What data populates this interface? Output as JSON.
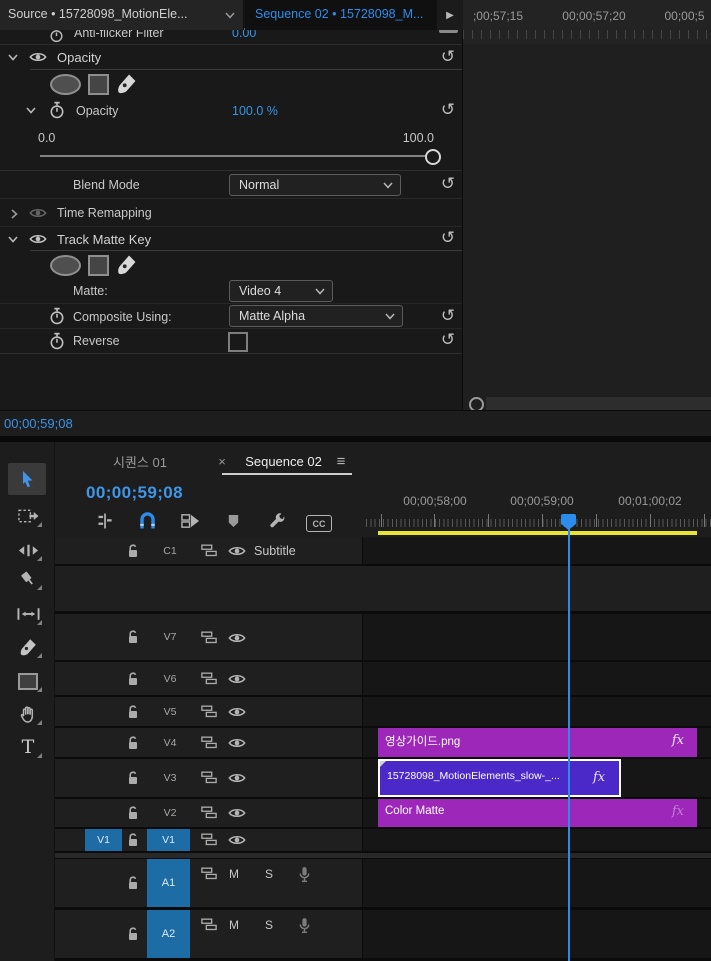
{
  "glyphs": {
    "reset": "↺",
    "panel_arrow": "▶",
    "tab_close": "×",
    "tab_menu": "≡",
    "type_tool": "T"
  },
  "effect_controls": {
    "source_tab": "Source • 15728098_MotionEle...",
    "sequence_tab": "Sequence 02 • 15728098_M...",
    "ruler": {
      "t1": ";00;57;15",
      "t2": "00;00;57;20",
      "t3": "00;00;5"
    },
    "anti_flicker": {
      "label": "Anti-flicker Filter",
      "value": "0.00"
    },
    "opacity_section": "Opacity",
    "opacity": {
      "label": "Opacity",
      "value": "100.0 %",
      "min": "0.0",
      "max": "100.0"
    },
    "blend_mode": {
      "label": "Blend Mode",
      "value": "Normal"
    },
    "time_remapping": "Time Remapping",
    "track_matte_key": "Track Matte Key",
    "matte": {
      "label": "Matte:",
      "value": "Video 4"
    },
    "composite": {
      "label": "Composite Using:",
      "value": "Matte Alpha"
    },
    "reverse": {
      "label": "Reverse"
    },
    "timecode": "00;00;59;08"
  },
  "timeline": {
    "sequence1_tab": "시퀀스 01",
    "sequence2_tab": "Sequence 02",
    "timecode": "00;00;59;08",
    "ruler": {
      "t1": "00;00;58;00",
      "t2": "00;00;59;00",
      "t3": "00;01;00;02"
    },
    "captions": "CC",
    "tracks": {
      "c1": {
        "label": "C1",
        "name": "Subtitle"
      },
      "v7": {
        "label": "V7"
      },
      "v6": {
        "label": "V6"
      },
      "v5": {
        "label": "V5"
      },
      "v4": {
        "label": "V4"
      },
      "v3": {
        "label": "V3"
      },
      "v2": {
        "label": "V2"
      },
      "v1": {
        "label": "V1",
        "patch": "V1"
      },
      "a1": {
        "label": "A1",
        "mute": "M",
        "solo": "S"
      },
      "a2": {
        "label": "A2",
        "mute": "M",
        "solo": "S"
      }
    },
    "clips": {
      "v4": {
        "name": "영상가이드.png",
        "fx": "fx"
      },
      "v3": {
        "name": "15728098_MotionElements_slow-_...",
        "fx": "fx"
      },
      "v2": {
        "name": "Color Matte",
        "fx": "fx"
      }
    }
  },
  "colors": {
    "accent_blue": "#2d8ceb",
    "clip_purple": "#9c27b9",
    "clip_selected_purple": "#4b28c8",
    "render_bar_yellow": "#e8e434",
    "track_target_blue": "#1d6ca5"
  }
}
